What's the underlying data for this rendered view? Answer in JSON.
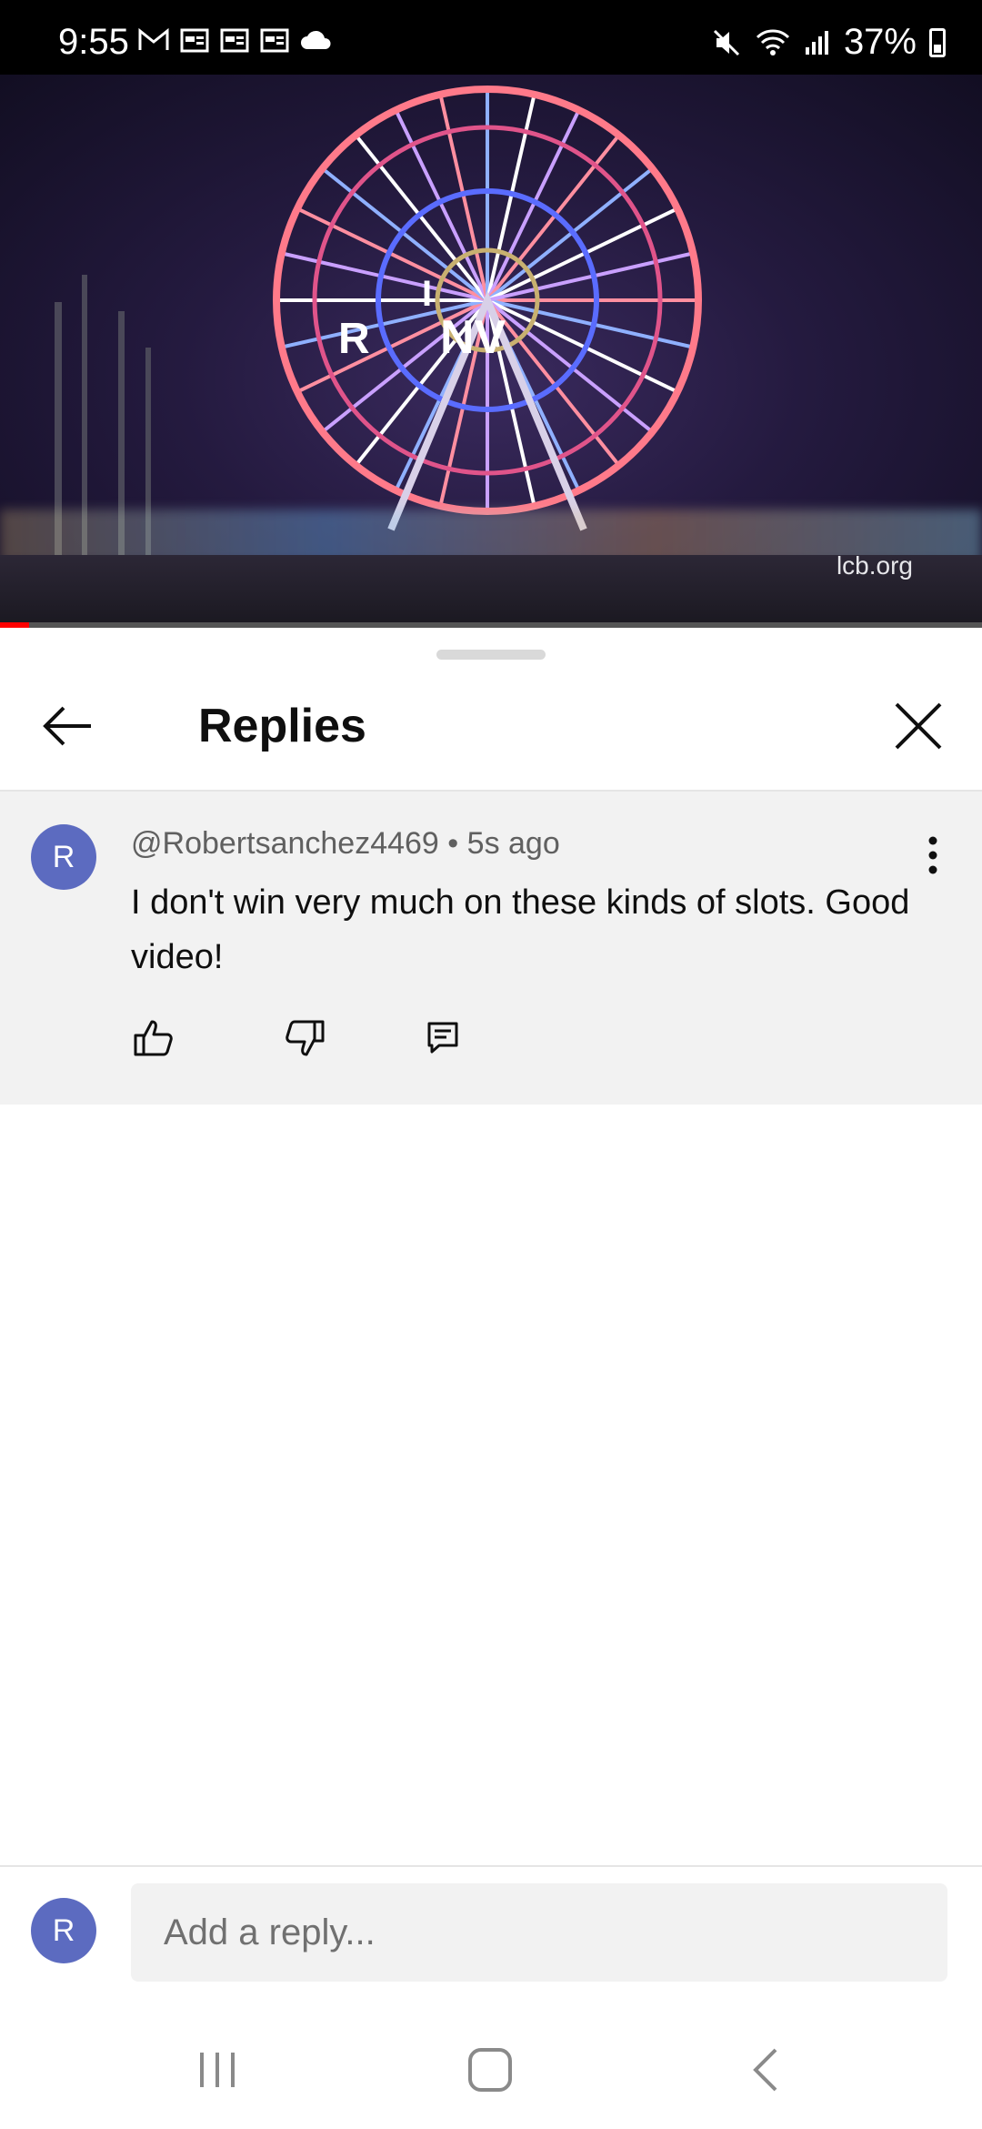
{
  "status_bar": {
    "time": "9:55",
    "battery": "37%",
    "left_icons": [
      "gmail-icon",
      "calendar-icon",
      "calendar-icon",
      "calendar-icon",
      "cloud-icon"
    ],
    "right_icons": [
      "mute-icon",
      "wifi-icon",
      "signal-icon",
      "battery-icon"
    ]
  },
  "video": {
    "sign_letters": [
      "R",
      "I",
      "NV"
    ],
    "watermark": "lcb.org",
    "progress": 0.03
  },
  "header": {
    "title": "Replies"
  },
  "comment": {
    "avatar_letter": "R",
    "author": "@Robertsanchez4469",
    "separator": "•",
    "time": "5s ago",
    "text": "I don't win very much on these kinds of slots. Good video!"
  },
  "reply": {
    "avatar_letter": "R",
    "placeholder": "Add a reply..."
  },
  "colors": {
    "avatar": "#5c6bc0",
    "comment_bg": "#f2f2f2",
    "progress": "#ff0000"
  }
}
